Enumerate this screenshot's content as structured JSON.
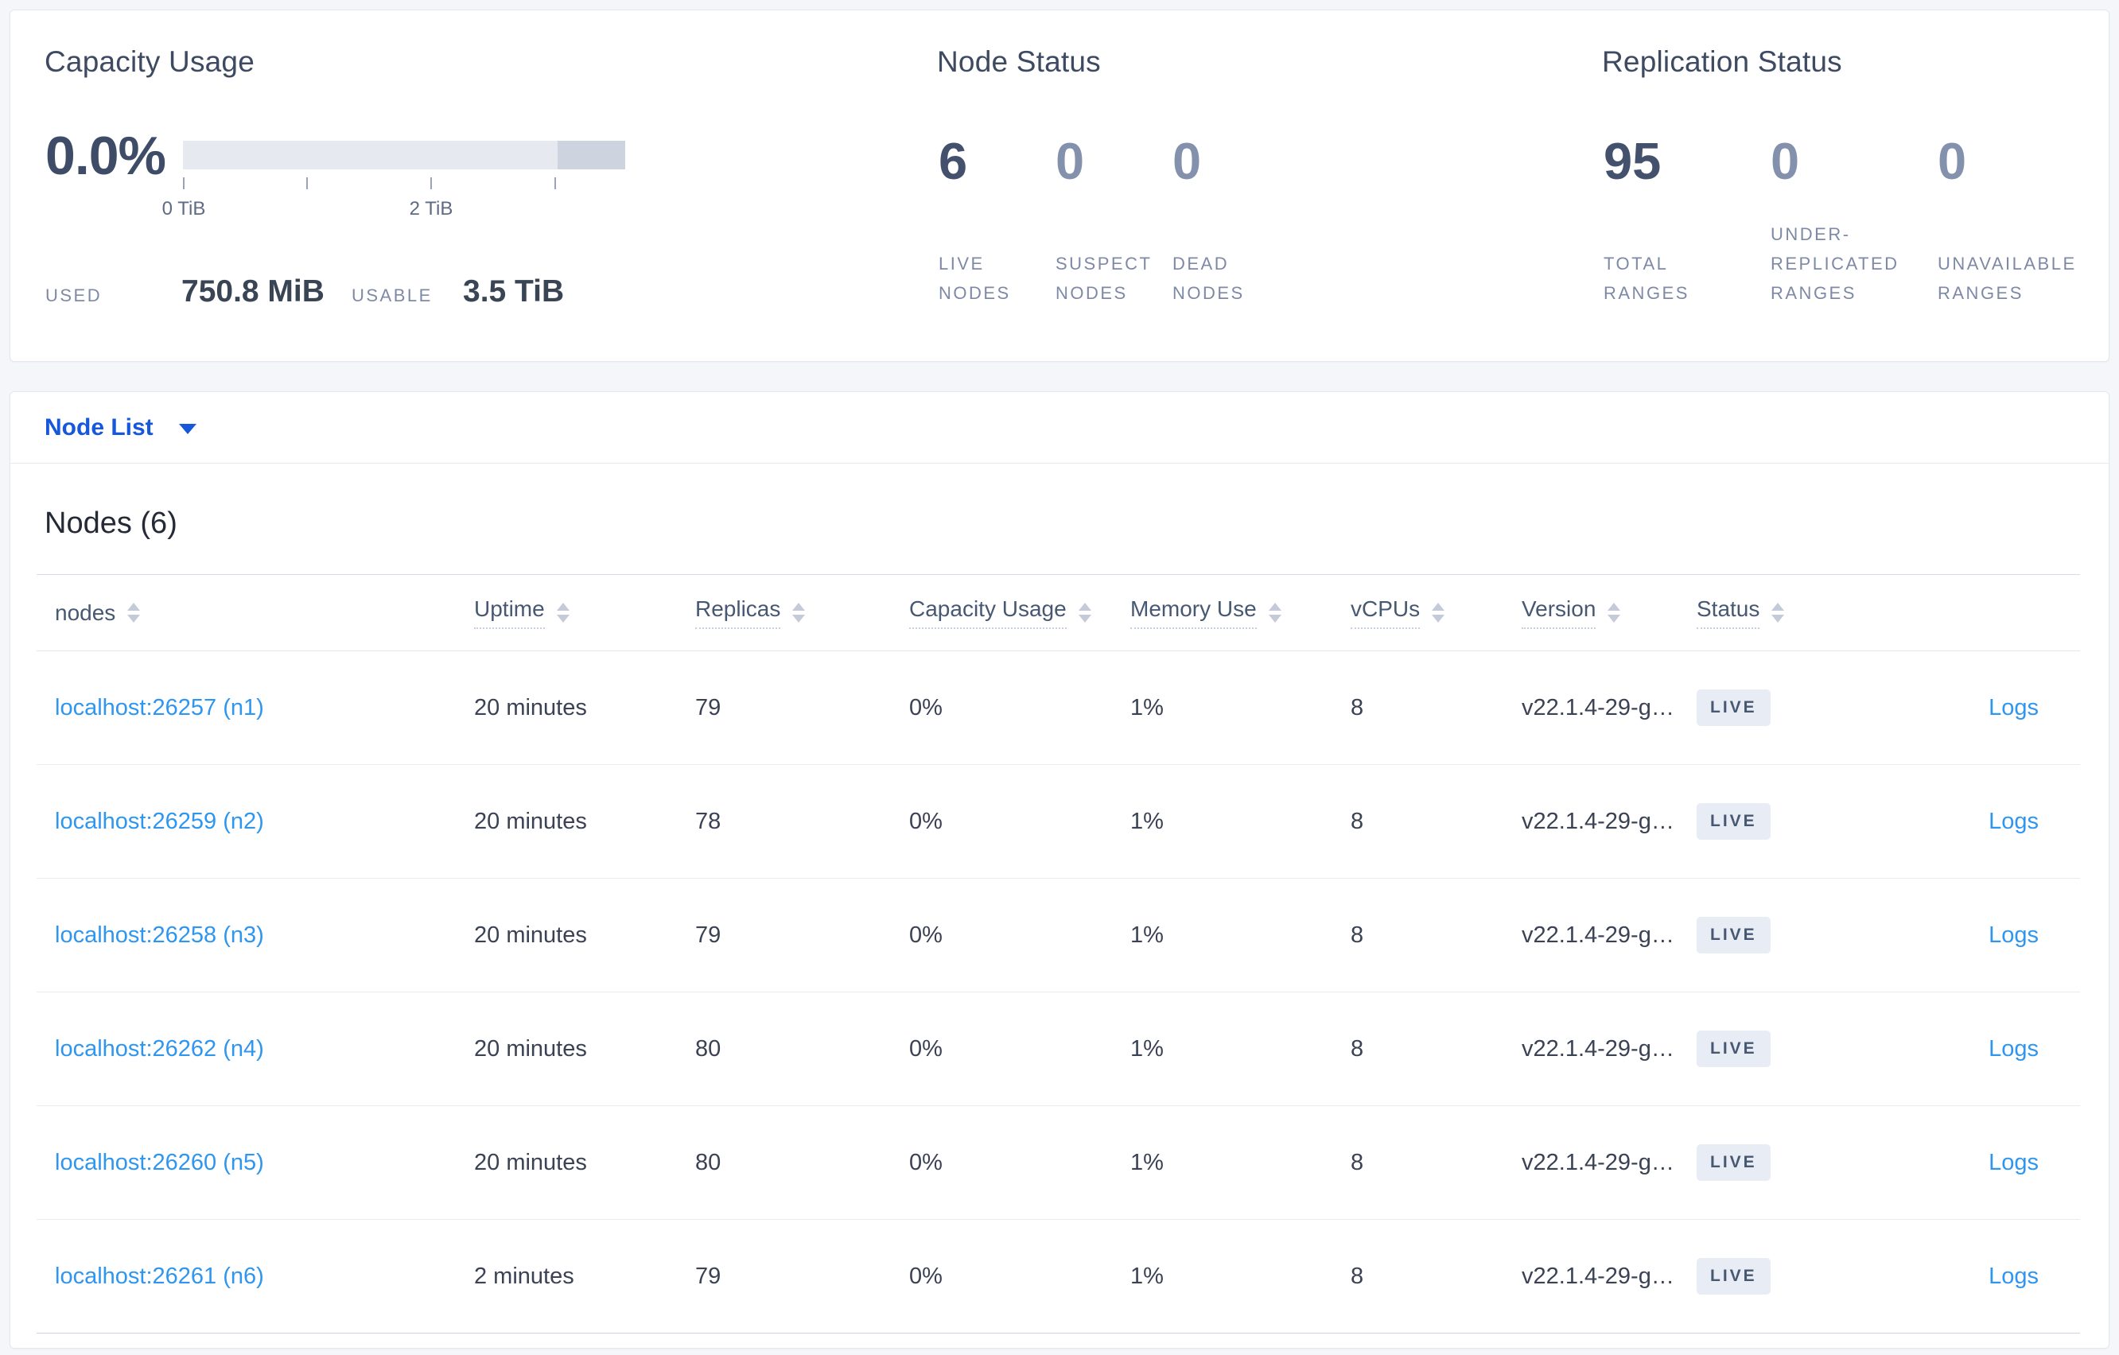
{
  "summary": {
    "capacity": {
      "title": "Capacity Usage",
      "percent": "0.0%",
      "used_label": "USED",
      "used_value": "750.8 MiB",
      "usable_label": "USABLE",
      "usable_value": "3.5 TiB",
      "tick_labels": [
        "0 TiB",
        "2 TiB"
      ],
      "bar_light_color": "#e7e9f1",
      "bar_dark_color": "#ced3e0"
    },
    "node_status": {
      "title": "Node Status",
      "stats": [
        {
          "value": "6",
          "label": "LIVE NODES"
        },
        {
          "value": "0",
          "label": "SUSPECT NODES"
        },
        {
          "value": "0",
          "label": "DEAD NODES"
        }
      ]
    },
    "replication": {
      "title": "Replication Status",
      "stats": [
        {
          "value": "95",
          "label": "TOTAL RANGES"
        },
        {
          "value": "0",
          "label": "UNDER-REPLICATED RANGES"
        },
        {
          "value": "0",
          "label": "UNAVAILABLE RANGES"
        }
      ]
    }
  },
  "node_list": {
    "dropdown_label": "Node List",
    "section_title": "Nodes (6)",
    "columns": [
      {
        "label": "nodes"
      },
      {
        "label": "Uptime"
      },
      {
        "label": "Replicas"
      },
      {
        "label": "Capacity Usage"
      },
      {
        "label": "Memory Use"
      },
      {
        "label": "vCPUs"
      },
      {
        "label": "Version"
      },
      {
        "label": "Status"
      }
    ],
    "logs_label": "Logs",
    "rows": [
      {
        "address": "localhost:26257 (n1)",
        "uptime": "20 minutes",
        "replicas": "79",
        "capacity": "0%",
        "memory": "1%",
        "vcpus": "8",
        "version": "v22.1.4-29-g…",
        "status": "LIVE"
      },
      {
        "address": "localhost:26259 (n2)",
        "uptime": "20 minutes",
        "replicas": "78",
        "capacity": "0%",
        "memory": "1%",
        "vcpus": "8",
        "version": "v22.1.4-29-g…",
        "status": "LIVE"
      },
      {
        "address": "localhost:26258 (n3)",
        "uptime": "20 minutes",
        "replicas": "79",
        "capacity": "0%",
        "memory": "1%",
        "vcpus": "8",
        "version": "v22.1.4-29-g…",
        "status": "LIVE"
      },
      {
        "address": "localhost:26262 (n4)",
        "uptime": "20 minutes",
        "replicas": "80",
        "capacity": "0%",
        "memory": "1%",
        "vcpus": "8",
        "version": "v22.1.4-29-g…",
        "status": "LIVE"
      },
      {
        "address": "localhost:26260 (n5)",
        "uptime": "20 minutes",
        "replicas": "80",
        "capacity": "0%",
        "memory": "1%",
        "vcpus": "8",
        "version": "v22.1.4-29-g…",
        "status": "LIVE"
      },
      {
        "address": "localhost:26261 (n6)",
        "uptime": "2 minutes",
        "replicas": "79",
        "capacity": "0%",
        "memory": "1%",
        "vcpus": "8",
        "version": "v22.1.4-29-g…",
        "status": "LIVE"
      }
    ],
    "link_color": "#2f96f0",
    "nav_link_color": "#1657db"
  }
}
